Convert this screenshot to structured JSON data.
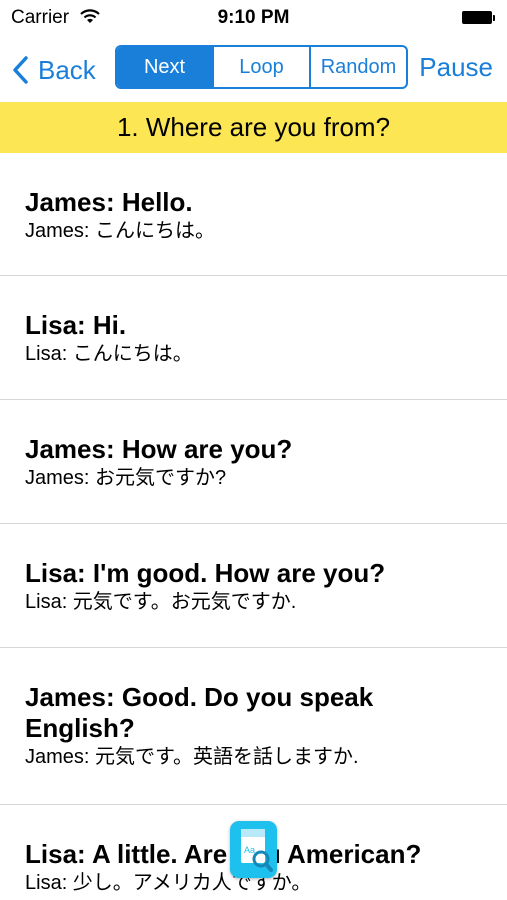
{
  "status_bar": {
    "carrier": "Carrier",
    "time": "9:10 PM"
  },
  "nav": {
    "back_label": "Back",
    "segments": [
      {
        "label": "Next",
        "selected": true
      },
      {
        "label": "Loop",
        "selected": false
      },
      {
        "label": "Random",
        "selected": false
      }
    ],
    "pause_label": "Pause"
  },
  "lesson": {
    "title": "1. Where are you from?"
  },
  "dialogue": [
    {
      "english": "James: Hello.",
      "japanese": "James: こんにちは。"
    },
    {
      "english": "Lisa: Hi.",
      "japanese": "Lisa: こんにちは。"
    },
    {
      "english": "James: How are you?",
      "japanese": "James: お元気ですか?"
    },
    {
      "english": "Lisa: I'm good. How are you?",
      "japanese": "Lisa: 元気です。お元気ですか."
    },
    {
      "english": "James: Good. Do you speak English?",
      "japanese": "James: 元気です。英語を話しますか."
    },
    {
      "english": "Lisa: A little. Are you American?",
      "japanese": "Lisa: 少し。アメリカ人ですか。"
    }
  ],
  "floating_icon": {
    "name": "dictionary-search-icon",
    "glyph": "Aa"
  },
  "colors": {
    "accent": "#1a7fd8",
    "header_bg": "#fce653",
    "icon_bg": "#1ec0ee"
  }
}
